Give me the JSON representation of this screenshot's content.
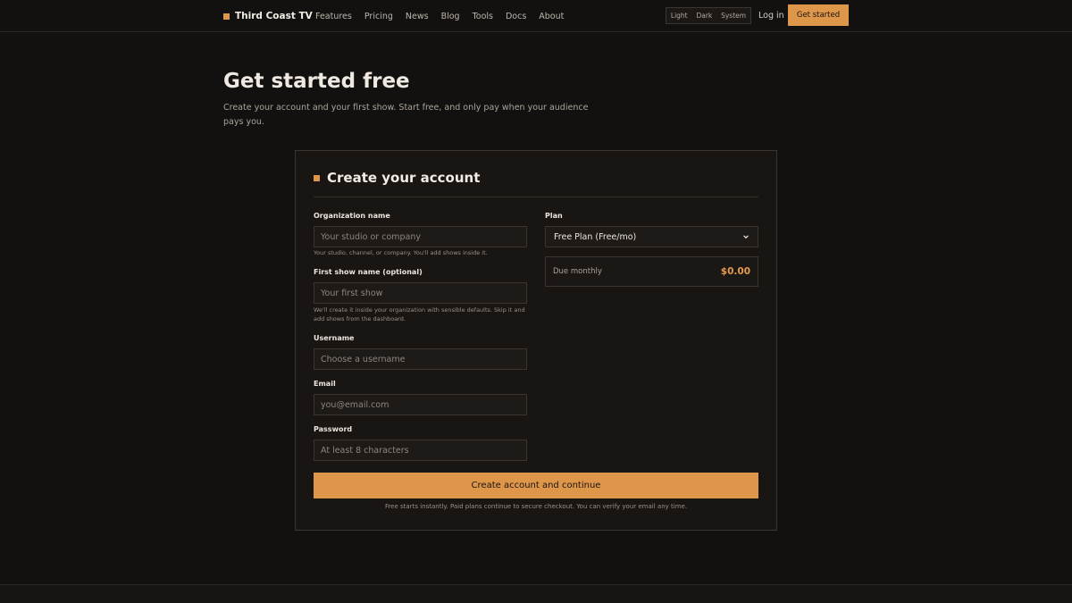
{
  "brand": {
    "name": "Third Coast TV"
  },
  "nav": {
    "items": [
      "Features",
      "Pricing",
      "News",
      "Blog",
      "Tools",
      "Docs",
      "About"
    ]
  },
  "theme": {
    "options": [
      "Light",
      "Dark",
      "System"
    ]
  },
  "header": {
    "login_label": "Log in",
    "cta_label": "Get started"
  },
  "hero": {
    "title": "Get started free",
    "subtitle": "Create your account and your first show. Start free, and only pay when your audience pays you."
  },
  "form": {
    "title": "Create your account",
    "org": {
      "label": "Organization name",
      "placeholder": "Your studio or company",
      "hint": "Your studio, channel, or company. You'll add shows inside it."
    },
    "show": {
      "label": "First show name (optional)",
      "placeholder": "Your first show",
      "hint": "We'll create it inside your organization with sensible defaults. Skip it and add shows from the dashboard."
    },
    "username": {
      "label": "Username",
      "placeholder": "Choose a username"
    },
    "email": {
      "label": "Email",
      "placeholder": "you@email.com"
    },
    "password": {
      "label": "Password",
      "placeholder": "At least 8 characters"
    },
    "plan": {
      "label": "Plan",
      "selected": "Free Plan (Free/mo)"
    },
    "due": {
      "label": "Due monthly",
      "amount": "$0.00"
    },
    "submit_label": "Create account and continue",
    "footnote": "Free starts instantly. Paid plans continue to secure checkout. You can verify your email any time."
  },
  "colors": {
    "background": "#131110",
    "accent": "#de964b",
    "card": "#181513",
    "border": "#3a3531"
  }
}
